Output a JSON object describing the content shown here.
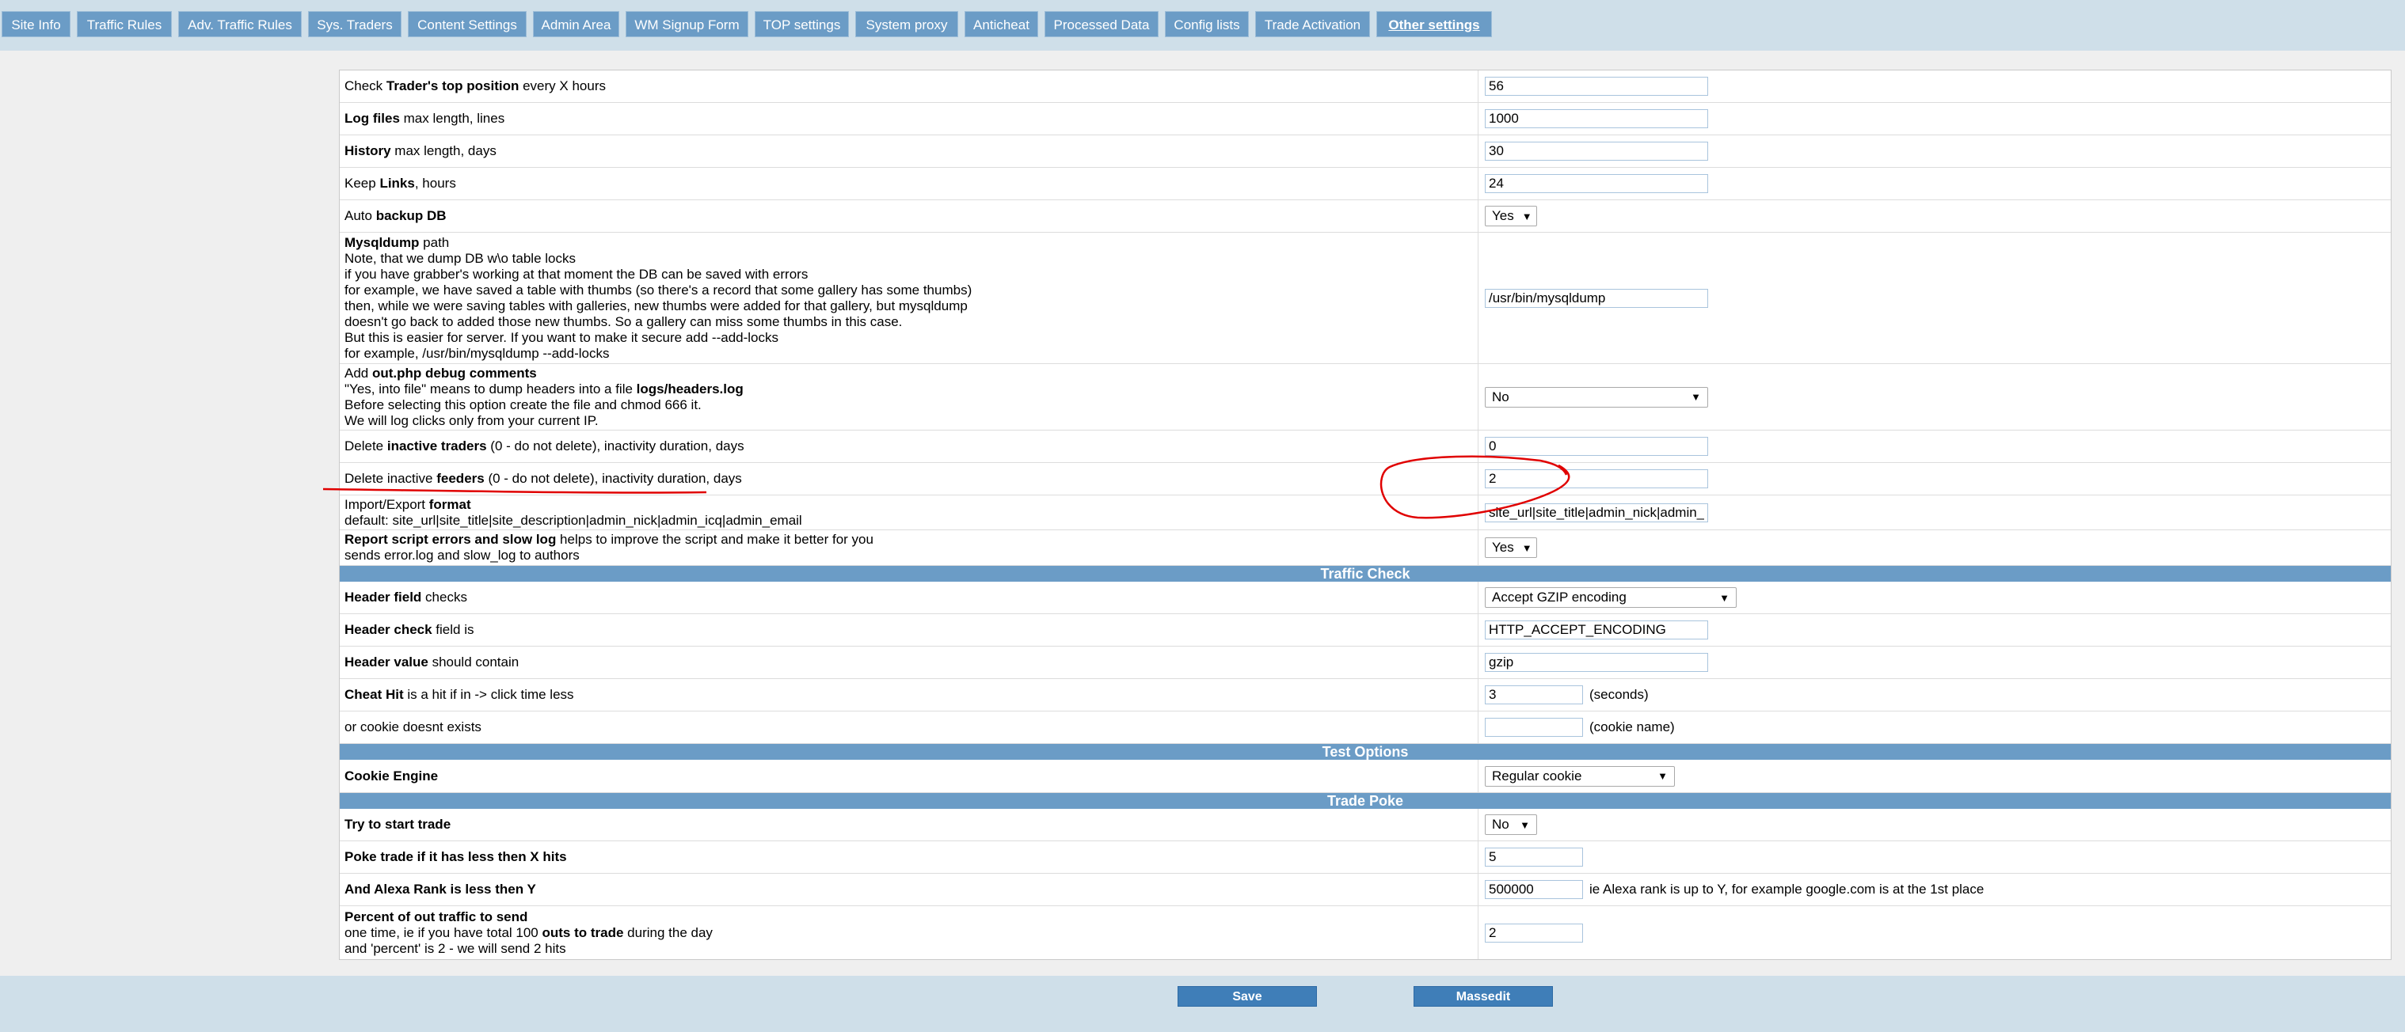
{
  "tabs": [
    "Site Info",
    "Traffic Rules",
    "Adv. Traffic Rules",
    "Sys. Traders",
    "Content Settings",
    "Admin Area",
    "WM Signup Form",
    "TOP settings",
    "System proxy",
    "Anticheat",
    "Processed Data",
    "Config lists",
    "Trade Activation",
    "Other settings"
  ],
  "rows": {
    "top": {
      "pre": "Check ",
      "bold": "Trader's top position",
      "post": " every X hours",
      "value": "56"
    },
    "log": {
      "bold": "Log files",
      "post": " max length, lines",
      "value": "1000"
    },
    "history": {
      "bold": "History",
      "post": " max length, days",
      "value": "30"
    },
    "links": {
      "pre": "Keep ",
      "bold": "Links",
      "post": ", hours",
      "value": "24"
    },
    "backup": {
      "pre": "Auto ",
      "bold": "backup DB",
      "value": "Yes"
    },
    "mysqldump": {
      "bold": "Mysqldump",
      "post": " path",
      "lines": [
        "Note, that we dump DB w\\o table locks",
        "if you have grabber's working at that moment the DB can be saved with errors",
        "for example, we have saved a table with thumbs (so there's a record that some gallery has some thumbs)",
        "then, while we were saving tables with galleries, new thumbs were added for that gallery, but mysqldump",
        "doesn't go back to added those new thumbs. So a gallery can miss some thumbs in this case.",
        "But this is easier for server. If you want to make it secure add --add-locks",
        "for example, /usr/bin/mysqldump --add-locks"
      ],
      "value": "/usr/bin/mysqldump"
    },
    "debug": {
      "pre": "Add ",
      "bold": "out.php debug comments",
      "l2_pre": "\"Yes, into file\" means to dump headers into a file ",
      "l2_bold": "logs/headers.log",
      "l3": "Before selecting this option create the file and chmod 666 it.",
      "l4": "We will log clicks only from your current IP.",
      "value": "No"
    },
    "del_traders": {
      "pre": "Delete ",
      "bold": "inactive traders",
      "post": " (0 - do not delete), inactivity duration, days",
      "value": "0"
    },
    "del_feeders": {
      "pre": "Delete inactive ",
      "bold": "feeders",
      "post": " (0 - do not delete), inactivity duration, days",
      "value": "2"
    },
    "import": {
      "pre": "Import/Export ",
      "bold": "format",
      "l2": "default: site_url|site_title|site_description|admin_nick|admin_icq|admin_email",
      "value": "site_url|site_title|admin_nick|admin_icq"
    },
    "report": {
      "bold": "Report script errors and slow log",
      "post": " helps to improve the script and make it better for you",
      "l2": "sends error.log and slow_log to authors",
      "value": "Yes"
    }
  },
  "sections": {
    "traffic": "Traffic Check",
    "test": "Test Options",
    "poke": "Trade Poke"
  },
  "traffic": {
    "hfield": {
      "bold": "Header field",
      "post": " checks",
      "value": "Accept GZIP encoding"
    },
    "hcheck": {
      "bold": "Header check",
      "post": " field is",
      "value": "HTTP_ACCEPT_ENCODING"
    },
    "hvalue": {
      "bold": "Header value",
      "post": " should contain",
      "value": "gzip"
    },
    "cheat": {
      "bold": "Cheat Hit",
      "post": " is a hit if in -> click time less",
      "value": "3",
      "after": "(seconds)"
    },
    "cookie": {
      "label": "or cookie doesnt exists",
      "value": "",
      "after": "(cookie name)"
    }
  },
  "test": {
    "engine": {
      "bold": "Cookie Engine",
      "value": "Regular cookie"
    }
  },
  "poke": {
    "start": {
      "bold": "Try to start trade",
      "value": "No"
    },
    "hits": {
      "bold": "Poke trade if it has less then X hits",
      "value": "5"
    },
    "alexa": {
      "bold": "And Alexa Rank is less then Y",
      "value": "500000",
      "after": "ie Alexa rank is up to Y, for example google.com is at the 1st place"
    },
    "percent": {
      "bold": "Percent of out traffic to send",
      "l2_pre": "one time, ie if you have total 100 ",
      "l2_bold": "outs to trade",
      "l2_post": " during the day",
      "l3": "and 'percent' is 2 - we will send 2 hits",
      "value": "2"
    }
  },
  "buttons": {
    "save": "Save",
    "massedit": "Massedit"
  },
  "colors": {
    "tab": "#6b9cc6",
    "bar": "#cfdfe9",
    "button": "#3f7eb8",
    "annotation": "#e00000"
  }
}
